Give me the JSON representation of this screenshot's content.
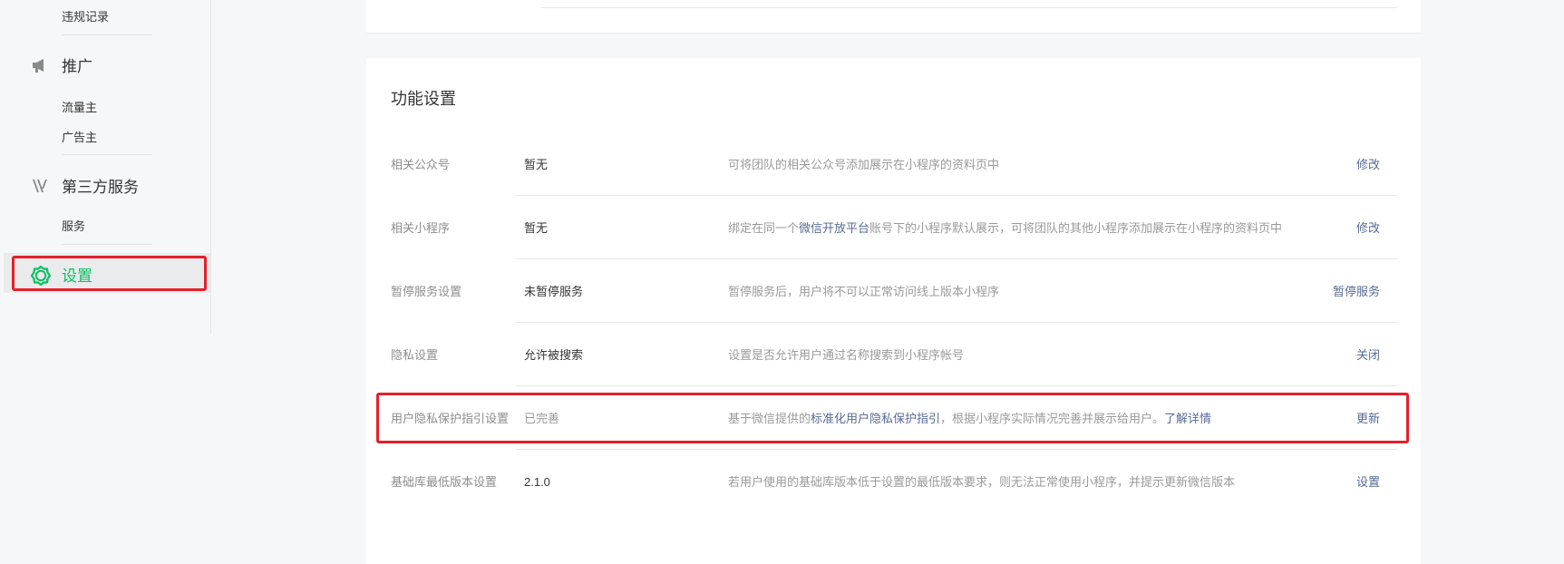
{
  "sidebar": {
    "top_item": "违规记录",
    "promotion": {
      "title": "推广",
      "items": [
        "流量主",
        "广告主"
      ]
    },
    "third_party": {
      "title": "第三方服务",
      "items": [
        "服务"
      ]
    },
    "settings": {
      "title": "设置"
    }
  },
  "main": {
    "section_title": "功能设置",
    "rows": [
      {
        "label": "相关公众号",
        "value": "暂无",
        "desc": "可将团队的相关公众号添加展示在小程序的资料页中",
        "action": "修改"
      },
      {
        "label": "相关小程序",
        "value": "暂无",
        "desc_parts": [
          "绑定在同一个",
          "微信开放平台",
          "账号下的小程序默认展示，可将团队的其他小程序添加展示在小程序的资料页中"
        ],
        "action": "修改"
      },
      {
        "label": "暂停服务设置",
        "value": "未暂停服务",
        "desc": "暂停服务后，用户将不可以正常访问线上版本小程序",
        "action": "暂停服务"
      },
      {
        "label": "隐私设置",
        "value": "允许被搜索",
        "desc": "设置是否允许用户通过名称搜索到小程序帐号",
        "action": "关闭"
      },
      {
        "label": "用户隐私保护指引设置",
        "value": "已完善",
        "desc_parts": [
          "基于微信提供的",
          "标准化用户隐私保护指引",
          "，根据小程序实际情况完善并展示给用户。",
          "了解详情"
        ],
        "action": "更新"
      },
      {
        "label": "基础库最低版本设置",
        "value": "2.1.0",
        "desc": "若用户使用的基础库版本低于设置的最低版本要求，则无法正常使用小程序，并提示更新微信版本",
        "action": "设置"
      }
    ]
  },
  "colors": {
    "accent_green": "#07c160",
    "link_blue": "#576b95",
    "highlight_red": "#e5202a"
  }
}
